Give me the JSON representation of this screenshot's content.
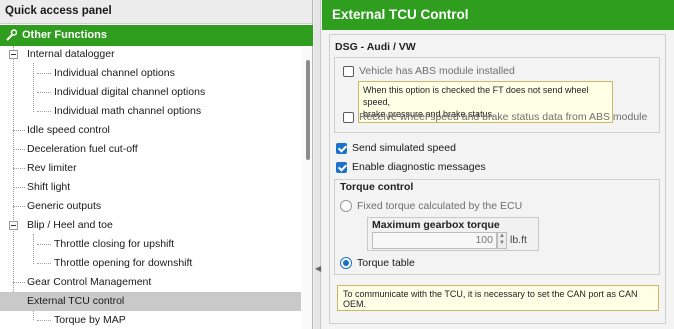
{
  "left_panel": {
    "title": "Quick access panel",
    "group_label": "Other Functions",
    "items": [
      {
        "label": "Internal datalogger"
      },
      {
        "label": "Individual channel options"
      },
      {
        "label": "Individual digital channel options"
      },
      {
        "label": "Individual math channel options"
      },
      {
        "label": "Idle speed control"
      },
      {
        "label": "Deceleration fuel cut-off"
      },
      {
        "label": "Rev limiter"
      },
      {
        "label": "Shift light"
      },
      {
        "label": "Generic outputs"
      },
      {
        "label": "Blip / Heel and toe"
      },
      {
        "label": "Throttle closing for upshift"
      },
      {
        "label": "Throttle opening for downshift"
      },
      {
        "label": "Gear Control Management"
      },
      {
        "label": "External TCU control"
      },
      {
        "label": "Torque by MAP"
      }
    ]
  },
  "right_panel": {
    "title": "External TCU Control",
    "section_title": "DSG - Audi / VW",
    "abs_checkbox": {
      "label": "Vehicle has ABS module installed",
      "checked": false
    },
    "abs_tooltip_line1": "When this option is checked the FT does not send wheel speed,",
    "abs_tooltip_line2": "brake pressure and brake status.",
    "receive_checkbox": {
      "label": "Receive wheel speed and brake status data from ABS module",
      "checked": false
    },
    "simulated_speed_checkbox": {
      "label": "Send simulated speed",
      "checked": true
    },
    "diagnostic_checkbox": {
      "label": "Enable diagnostic messages",
      "checked": true
    },
    "torque_control": {
      "title": "Torque control",
      "fixed_radio_label": "Fixed torque calculated by the ECU",
      "max_torque_label": "Maximum gearbox torque",
      "max_torque_value": "100",
      "max_torque_unit": "lb.ft",
      "table_radio_label": "Torque table",
      "selected": "Torque table"
    },
    "note": "To communicate with the TCU, it is necessary to set the CAN port as CAN OEM."
  },
  "colors": {
    "accent": "#2f9e1f",
    "checkbox_blue": "#1a73c8",
    "tooltip_bg": "#ffffe6"
  }
}
